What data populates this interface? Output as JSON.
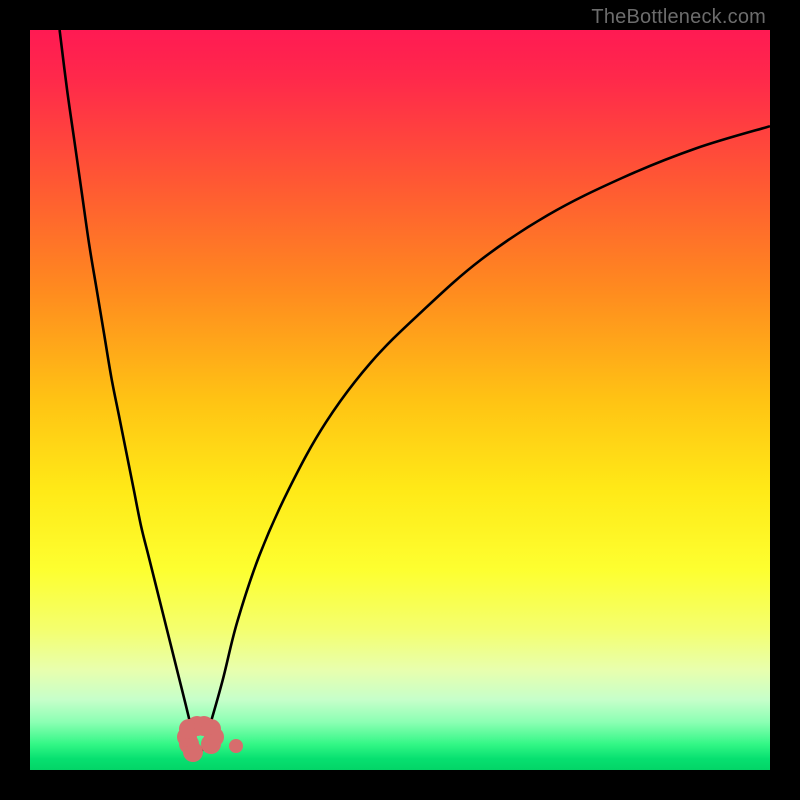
{
  "watermark": "TheBottleneck.com",
  "colors": {
    "frame": "#000000",
    "curve": "#000000",
    "blob": "#d76d6d",
    "gradient_stops": [
      {
        "pos": 0.0,
        "color": "#ff1a53"
      },
      {
        "pos": 0.07,
        "color": "#ff2a4a"
      },
      {
        "pos": 0.2,
        "color": "#ff5634"
      },
      {
        "pos": 0.35,
        "color": "#ff8a1f"
      },
      {
        "pos": 0.5,
        "color": "#ffc314"
      },
      {
        "pos": 0.62,
        "color": "#ffe917"
      },
      {
        "pos": 0.73,
        "color": "#fdff30"
      },
      {
        "pos": 0.81,
        "color": "#f4ff6e"
      },
      {
        "pos": 0.865,
        "color": "#e8ffae"
      },
      {
        "pos": 0.905,
        "color": "#c6ffca"
      },
      {
        "pos": 0.935,
        "color": "#8cffb4"
      },
      {
        "pos": 0.965,
        "color": "#33f786"
      },
      {
        "pos": 0.985,
        "color": "#07e070"
      },
      {
        "pos": 1.0,
        "color": "#03d467"
      }
    ]
  },
  "chart_data": {
    "type": "line",
    "title": "",
    "xlabel": "",
    "ylabel": "",
    "xlim": [
      0,
      100
    ],
    "ylim": [
      0,
      100
    ],
    "min_x": 23,
    "series": [
      {
        "name": "left-branch",
        "x": [
          4,
          5,
          6,
          7,
          8,
          9,
          10,
          11,
          12,
          13,
          14,
          15,
          16,
          17,
          18,
          19,
          20,
          21,
          22,
          23
        ],
        "y": [
          100,
          92,
          85,
          78,
          71,
          65,
          59,
          53,
          48,
          43,
          38,
          33,
          29,
          25,
          21,
          17,
          13,
          9,
          5,
          2
        ]
      },
      {
        "name": "right-branch",
        "x": [
          23,
          24,
          26,
          28,
          31,
          35,
          40,
          46,
          53,
          61,
          70,
          80,
          90,
          100
        ],
        "y": [
          2,
          5,
          12,
          20,
          29,
          38,
          47,
          55,
          62,
          69,
          75,
          80,
          84,
          87
        ]
      }
    ],
    "markers": [
      {
        "name": "u-blob",
        "x": 22.0,
        "y": 2.5
      },
      {
        "name": "u-blob",
        "x": 21.5,
        "y": 3.5
      },
      {
        "name": "u-blob",
        "x": 21.2,
        "y": 4.5
      },
      {
        "name": "u-blob",
        "x": 21.5,
        "y": 5.5
      },
      {
        "name": "u-blob",
        "x": 22.5,
        "y": 6.0
      },
      {
        "name": "u-blob",
        "x": 23.5,
        "y": 6.0
      },
      {
        "name": "u-blob",
        "x": 24.5,
        "y": 5.5
      },
      {
        "name": "u-blob",
        "x": 24.8,
        "y": 4.5
      },
      {
        "name": "u-blob",
        "x": 24.5,
        "y": 3.5
      },
      {
        "name": "dot",
        "x": 27.8,
        "y": 3.2
      }
    ]
  }
}
